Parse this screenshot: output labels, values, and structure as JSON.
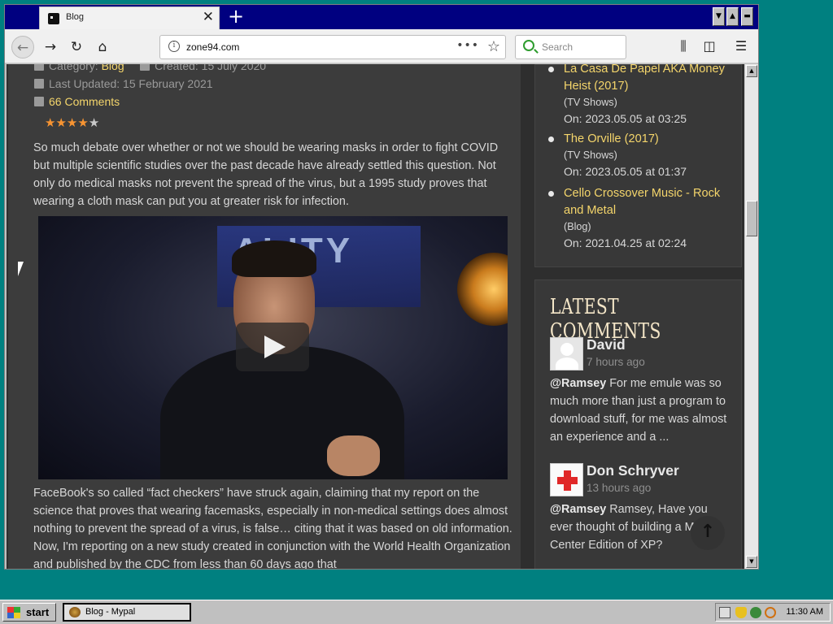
{
  "browser": {
    "tab_title": "Blog",
    "url": "zone94.com",
    "search_placeholder": "Search"
  },
  "article": {
    "meta_category_label": "Category:",
    "meta_category_value": "Blog",
    "meta_created": "Created: 15 July 2020",
    "meta_updated": "Last Updated: 15 February 2021",
    "comments_link": "66 Comments",
    "rating": {
      "value": 4,
      "max": 5
    },
    "paragraph1": "So much debate over whether or not we should be wearing masks in order to fight COVID but multiple scientific studies over the past decade have already settled this question. Not only do medical masks not prevent the spread of the virus, but a 1995 study proves that wearing a cloth mask can put you at greater risk for infection.",
    "video_sign": "ALITY",
    "paragraph2": "FaceBook's so called “fact checkers” have struck again, claiming that my report on the science that proves that wearing facemasks, especially in non-medical settings does almost nothing to prevent the spread of a virus, is false… citing that it was based on old information. Now, I'm reporting on a new study created in conjunction with the World Health Organization and published by the CDC from less than 60 days ago that"
  },
  "sidebar": {
    "items": [
      {
        "title": "La Casa De Papel AKA Money Heist (2017)",
        "category": "(TV Shows)",
        "date": "On: 2023.05.05 at 03:25"
      },
      {
        "title": "The Orville (2017)",
        "category": "(TV Shows)",
        "date": "On: 2023.05.05 at 01:37"
      },
      {
        "title": "Cello Crossover Music - Rock and Metal",
        "category": "(Blog)",
        "date": "On: 2021.04.25 at 02:24"
      }
    ]
  },
  "latest_comments": {
    "heading": "LATEST COMMENTS",
    "items": [
      {
        "name": "David",
        "time": "7 hours ago",
        "mention": "@Ramsey",
        "text": " For me emule was so much more than just a program to download stuff, for me was almost an experience and a ..."
      },
      {
        "name": "Don Schryver",
        "time": "13 hours ago",
        "mention": "@Ramsey",
        "text": " Ramsey, Have you ever thought of building a Media Center Edition of XP?"
      }
    ]
  },
  "taskbar": {
    "start_label": "start",
    "task_label": "Blog - Mypal",
    "clock": "11:30 AM"
  }
}
